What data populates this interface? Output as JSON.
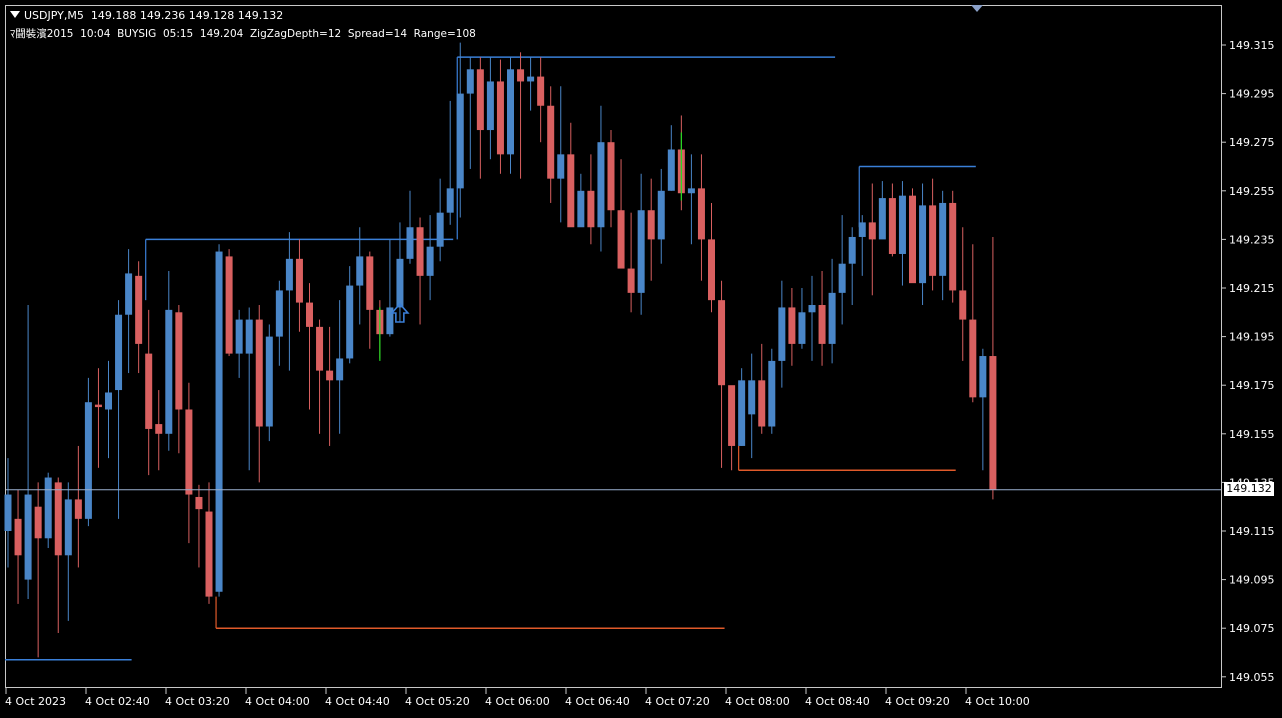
{
  "header": {
    "symbol_line": "USDJPY,M5  149.188 149.236 149.128 149.132",
    "indicator_line": "ﾏ闘裝濱2015  10:04  BUYSIG  05:15  149.204  ZigZagDepth=12  Spread=14  Range=108"
  },
  "current_price_label": "149.132",
  "colors": {
    "bull": "#4a86c8",
    "bear": "#d96060",
    "grid_line": "#9ab0d0",
    "level_high": "#3a7fd8",
    "level_low": "#e05a2a",
    "signal": "#22dd22"
  },
  "chart_data": {
    "type": "candlestick",
    "symbol": "USDJPY",
    "timeframe": "M5",
    "y_ticks": [
      "149.315",
      "149.295",
      "149.275",
      "149.255",
      "149.235",
      "149.215",
      "149.195",
      "149.175",
      "149.155",
      "149.135",
      "149.115",
      "149.095",
      "149.075",
      "149.055"
    ],
    "x_ticks": [
      "4 Oct 2023",
      "4 Oct 02:40",
      "4 Oct 03:20",
      "4 Oct 04:00",
      "4 Oct 04:40",
      "4 Oct 05:20",
      "4 Oct 06:00",
      "4 Oct 06:40",
      "4 Oct 07:20",
      "4 Oct 08:00",
      "4 Oct 08:40",
      "4 Oct 09:20",
      "4 Oct 10:00"
    ],
    "current_price": 149.132,
    "candles": [
      [
        149.115,
        149.13,
        149.145,
        149.1
      ],
      [
        149.12,
        149.105,
        149.132,
        149.085
      ],
      [
        149.095,
        149.13,
        149.208,
        149.087
      ],
      [
        149.125,
        149.112,
        149.135,
        149.063
      ],
      [
        149.112,
        149.137,
        149.139,
        149.108
      ],
      [
        149.135,
        149.105,
        149.137,
        149.073
      ],
      [
        149.105,
        149.128,
        149.135,
        149.078
      ],
      [
        149.128,
        149.12,
        149.15,
        149.1
      ],
      [
        149.12,
        149.168,
        149.178,
        149.117
      ],
      [
        149.167,
        149.166,
        149.182,
        149.141
      ],
      [
        149.165,
        149.172,
        149.185,
        149.145
      ],
      [
        149.173,
        149.204,
        149.21,
        149.12
      ],
      [
        149.204,
        149.221,
        149.231,
        149.18
      ],
      [
        149.22,
        149.192,
        149.226,
        149.18
      ],
      [
        149.188,
        149.157,
        149.206,
        149.138
      ],
      [
        149.159,
        149.155,
        149.173,
        149.14
      ],
      [
        149.155,
        149.206,
        149.222,
        149.148
      ],
      [
        149.205,
        149.165,
        149.208,
        149.147
      ],
      [
        149.165,
        149.13,
        149.176,
        149.11
      ],
      [
        149.129,
        149.124,
        149.134,
        149.1
      ],
      [
        149.123,
        149.088,
        149.135,
        149.085
      ],
      [
        149.09,
        149.23,
        149.233,
        149.088
      ],
      [
        149.228,
        149.188,
        149.231,
        149.187
      ],
      [
        149.188,
        149.202,
        149.206,
        149.178
      ],
      [
        149.188,
        149.202,
        149.207,
        149.14
      ],
      [
        149.202,
        149.158,
        149.208,
        149.135
      ],
      [
        149.158,
        149.195,
        149.2,
        149.152
      ],
      [
        149.195,
        149.214,
        149.218,
        149.183
      ],
      [
        149.214,
        149.227,
        149.238,
        149.181
      ],
      [
        149.227,
        149.209,
        149.235,
        149.197
      ],
      [
        149.209,
        149.199,
        149.217,
        149.165
      ],
      [
        149.199,
        149.181,
        149.202,
        149.155
      ],
      [
        149.181,
        149.177,
        149.199,
        149.15
      ],
      [
        149.177,
        149.186,
        149.21,
        149.155
      ],
      [
        149.186,
        149.216,
        149.224,
        149.184
      ],
      [
        149.216,
        149.228,
        149.24,
        149.2
      ],
      [
        149.228,
        149.206,
        149.23,
        149.19
      ],
      [
        149.206,
        149.196,
        149.21,
        149.186
      ],
      [
        149.196,
        149.207,
        149.235,
        149.195
      ],
      [
        149.207,
        149.227,
        149.242,
        149.201
      ],
      [
        149.227,
        149.24,
        149.255,
        149.225
      ],
      [
        149.24,
        149.22,
        149.244,
        149.2
      ],
      [
        149.22,
        149.232,
        149.245,
        149.21
      ],
      [
        149.232,
        149.246,
        149.26,
        149.226
      ],
      [
        149.246,
        149.256,
        149.292,
        149.241
      ],
      [
        149.256,
        149.295,
        149.316,
        149.244
      ],
      [
        149.295,
        149.305,
        149.31,
        149.264
      ],
      [
        149.305,
        149.28,
        149.31,
        149.26
      ],
      [
        149.28,
        149.3,
        149.31,
        149.268
      ],
      [
        149.3,
        149.27,
        149.309,
        149.262
      ],
      [
        149.27,
        149.305,
        149.31,
        149.262
      ],
      [
        149.305,
        149.3,
        149.312,
        149.26
      ],
      [
        149.3,
        149.302,
        149.31,
        149.288
      ],
      [
        149.302,
        149.29,
        149.31,
        149.275
      ],
      [
        149.29,
        149.26,
        149.298,
        149.25
      ],
      [
        149.26,
        149.27,
        149.298,
        149.242
      ],
      [
        149.27,
        149.24,
        149.283,
        149.247
      ],
      [
        149.24,
        149.255,
        149.262,
        149.248
      ],
      [
        149.255,
        149.24,
        149.27,
        149.233
      ],
      [
        149.24,
        149.275,
        149.29,
        149.23
      ],
      [
        149.275,
        149.247,
        149.28,
        149.24
      ],
      [
        149.247,
        149.223,
        149.268,
        149.234
      ],
      [
        149.223,
        149.213,
        149.246,
        149.205
      ],
      [
        149.213,
        149.247,
        149.262,
        149.204
      ],
      [
        149.247,
        149.235,
        149.26,
        149.218
      ],
      [
        149.235,
        149.255,
        149.264,
        149.225
      ],
      [
        149.255,
        149.272,
        149.282,
        149.255
      ],
      [
        149.272,
        149.254,
        149.286,
        149.247
      ],
      [
        149.254,
        149.256,
        149.27,
        149.233
      ],
      [
        149.256,
        149.235,
        149.27,
        149.218
      ],
      [
        149.235,
        149.21,
        149.25,
        149.205
      ],
      [
        149.21,
        149.175,
        149.218,
        149.141
      ],
      [
        149.175,
        149.15,
        149.158,
        149.14
      ],
      [
        149.15,
        149.177,
        149.182,
        149.15
      ],
      [
        149.163,
        149.177,
        149.188,
        149.145
      ],
      [
        149.177,
        149.158,
        149.192,
        149.155
      ],
      [
        149.158,
        149.185,
        149.19,
        149.155
      ],
      [
        149.185,
        149.207,
        149.218,
        149.174
      ],
      [
        149.207,
        149.192,
        149.215,
        149.183
      ],
      [
        149.192,
        149.205,
        149.215,
        149.19
      ],
      [
        149.205,
        149.208,
        149.22,
        149.185
      ],
      [
        149.208,
        149.192,
        149.222,
        149.183
      ],
      [
        149.192,
        149.213,
        149.227,
        149.184
      ],
      [
        149.213,
        149.225,
        149.245,
        149.2
      ],
      [
        149.225,
        149.236,
        149.24,
        149.208
      ],
      [
        149.236,
        149.242,
        149.245,
        149.22
      ],
      [
        149.242,
        149.235,
        149.258,
        149.212
      ],
      [
        149.235,
        149.252,
        149.259,
        149.243
      ],
      [
        149.252,
        149.229,
        149.258,
        149.228
      ],
      [
        149.229,
        149.253,
        149.259,
        149.216
      ],
      [
        149.253,
        149.217,
        149.256,
        149.22
      ],
      [
        149.217,
        149.249,
        149.258,
        149.208
      ],
      [
        149.249,
        149.22,
        149.26,
        149.214
      ],
      [
        149.22,
        149.25,
        149.255,
        149.21
      ],
      [
        149.25,
        149.214,
        149.255,
        149.209
      ],
      [
        149.214,
        149.202,
        149.24,
        149.185
      ],
      [
        149.202,
        149.17,
        149.233,
        149.168
      ],
      [
        149.17,
        149.187,
        149.19,
        149.14
      ],
      [
        149.187,
        149.132,
        149.236,
        149.128
      ]
    ],
    "levels": [
      {
        "kind": "high",
        "price": 149.31,
        "from_bar": 45,
        "to_bar": 82
      },
      {
        "kind": "high",
        "price": 149.235,
        "from_bar": 14,
        "to_bar": 44
      },
      {
        "kind": "high",
        "price": 149.265,
        "from_bar": 85,
        "to_bar": 96
      },
      {
        "kind": "high",
        "price": 149.062,
        "from_bar": 0,
        "to_bar": 12
      },
      {
        "kind": "low",
        "price": 149.075,
        "from_bar": 21,
        "to_bar": 71
      },
      {
        "kind": "low",
        "price": 149.14,
        "from_bar": 73,
        "to_bar": 94
      }
    ],
    "signals": [
      {
        "bar": 37,
        "price": 149.208,
        "type": "buy-arrow"
      }
    ],
    "green_ticks": [
      {
        "bar": 37,
        "low": 149.185,
        "high": 149.207
      },
      {
        "bar": 67,
        "low": 149.251,
        "high": 149.279
      }
    ]
  }
}
